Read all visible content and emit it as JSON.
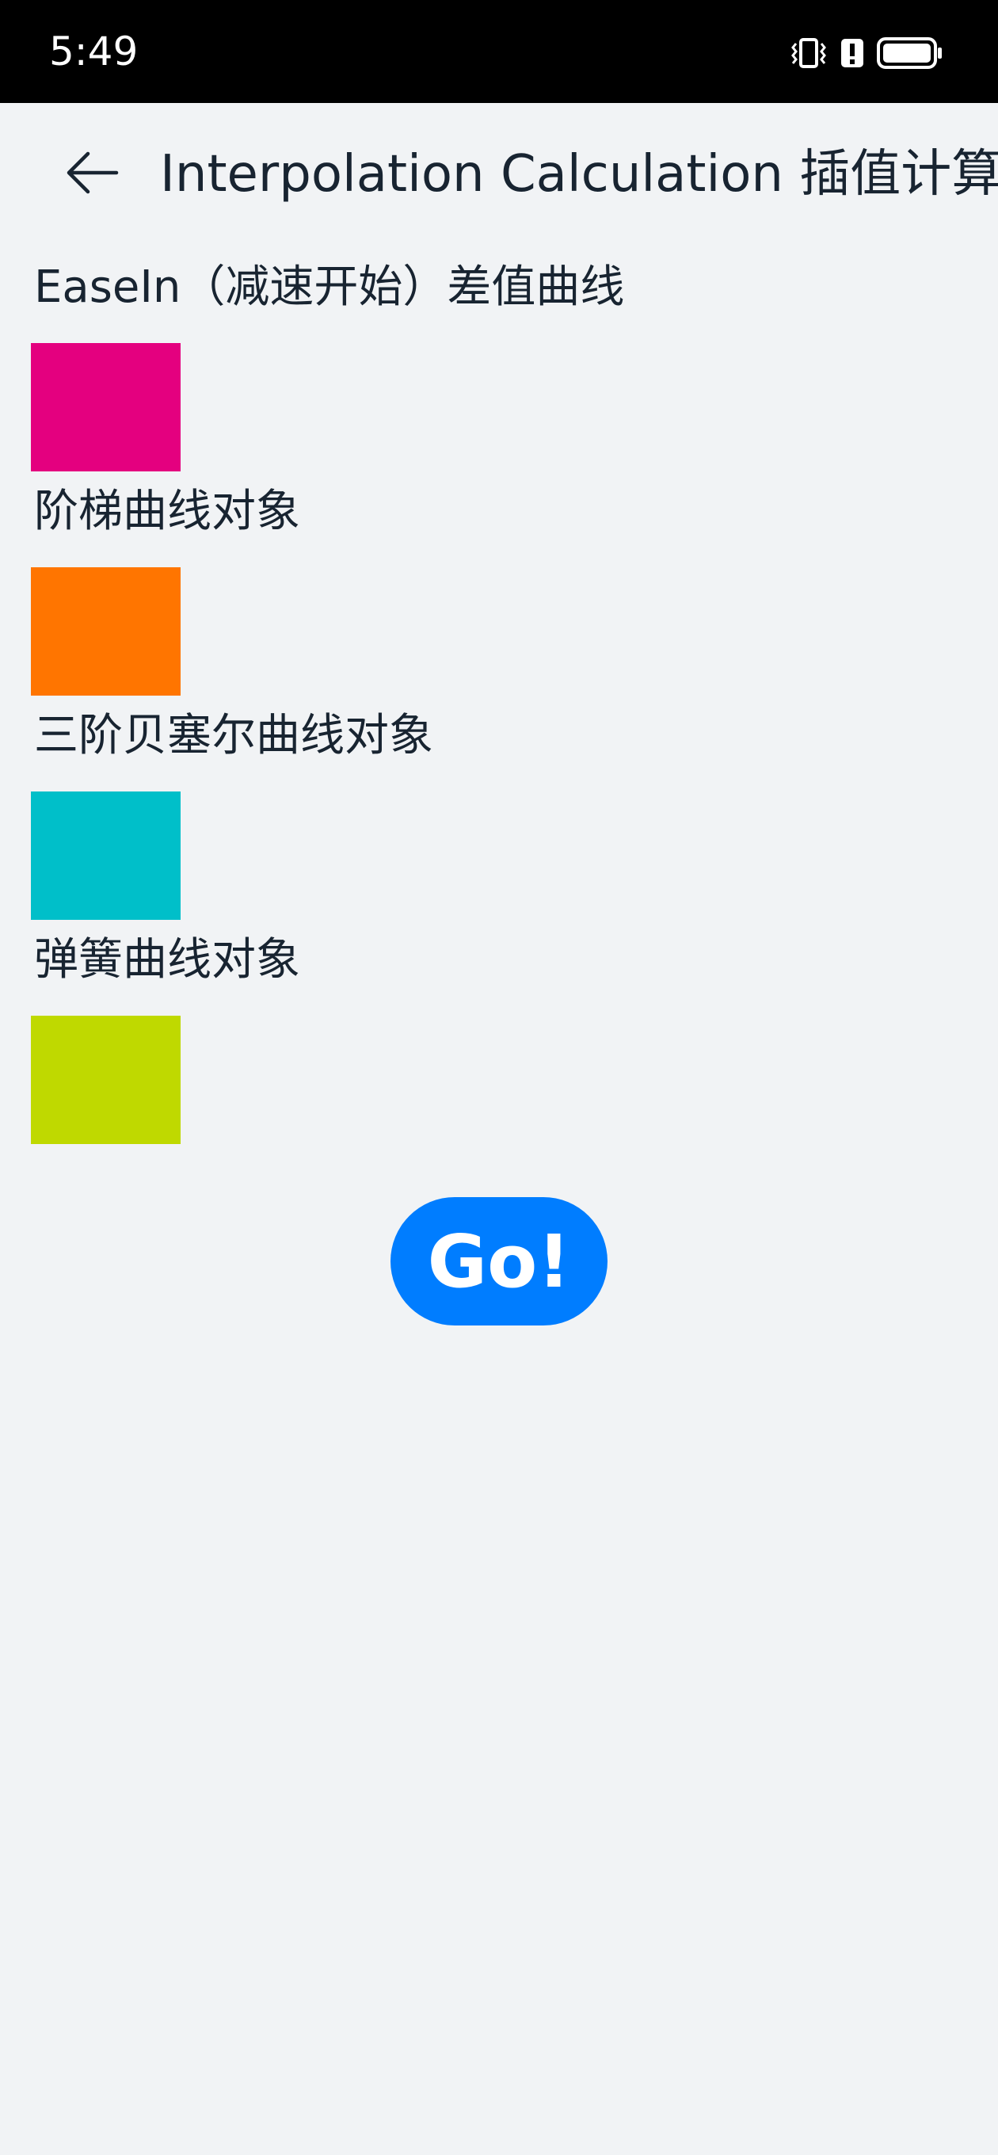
{
  "status_bar": {
    "time": "5:49",
    "icons": [
      "vibrate-icon",
      "alert-icon",
      "battery-icon"
    ]
  },
  "header": {
    "back_icon": "arrow-left-icon",
    "title": "Interpolation Calculation 插值计算"
  },
  "demos": [
    {
      "label": "EaseIn（减速开始）差值曲线",
      "color": "#e4007f"
    },
    {
      "label": "阶梯曲线对象",
      "color": "#ff7500"
    },
    {
      "label": "三阶贝塞尔曲线对象",
      "color": "#00bfc9"
    },
    {
      "label": "弹簧曲线对象",
      "color": "#bfd900"
    }
  ],
  "go_button": {
    "label": "Go!",
    "color": "#007dff"
  }
}
